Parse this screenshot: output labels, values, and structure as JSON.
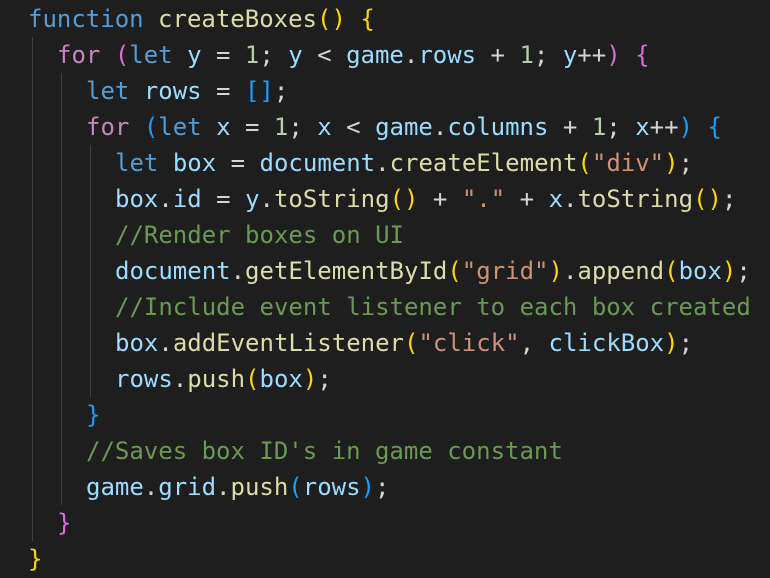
{
  "editor": {
    "theme": {
      "background": "#1e1e1e",
      "keyword": "#569cd6",
      "control": "#c586c0",
      "function": "#dcdcaa",
      "variable": "#9cdcfe",
      "number": "#b5cea8",
      "string": "#ce9178",
      "comment": "#6a9955",
      "bracket_level_1": "#ffd700",
      "bracket_level_2": "#da70d6",
      "bracket_level_3": "#179fff"
    },
    "lines": [
      {
        "indent": 0,
        "tokens": [
          [
            "kw",
            "function"
          ],
          [
            "op",
            " "
          ],
          [
            "fn",
            "createBoxes"
          ],
          [
            "b1",
            "()"
          ],
          [
            "op",
            " "
          ],
          [
            "b1",
            "{"
          ]
        ]
      },
      {
        "indent": 1,
        "tokens": [
          [
            "ctl",
            "for"
          ],
          [
            "op",
            " "
          ],
          [
            "b2",
            "("
          ],
          [
            "kw",
            "let"
          ],
          [
            "op",
            " "
          ],
          [
            "var",
            "y"
          ],
          [
            "op",
            " = "
          ],
          [
            "num",
            "1"
          ],
          [
            "op",
            "; "
          ],
          [
            "var",
            "y"
          ],
          [
            "op",
            " < "
          ],
          [
            "var",
            "game"
          ],
          [
            "op",
            "."
          ],
          [
            "var",
            "rows"
          ],
          [
            "op",
            " + "
          ],
          [
            "num",
            "1"
          ],
          [
            "op",
            "; "
          ],
          [
            "var",
            "y"
          ],
          [
            "op",
            "++"
          ],
          [
            "b2",
            ")"
          ],
          [
            "op",
            " "
          ],
          [
            "b2",
            "{"
          ]
        ]
      },
      {
        "indent": 2,
        "tokens": [
          [
            "kw",
            "let"
          ],
          [
            "op",
            " "
          ],
          [
            "var",
            "rows"
          ],
          [
            "op",
            " = "
          ],
          [
            "b3",
            "[]"
          ],
          [
            "op",
            ";"
          ]
        ]
      },
      {
        "indent": 2,
        "tokens": [
          [
            "ctl",
            "for"
          ],
          [
            "op",
            " "
          ],
          [
            "b3",
            "("
          ],
          [
            "kw",
            "let"
          ],
          [
            "op",
            " "
          ],
          [
            "var",
            "x"
          ],
          [
            "op",
            " = "
          ],
          [
            "num",
            "1"
          ],
          [
            "op",
            "; "
          ],
          [
            "var",
            "x"
          ],
          [
            "op",
            " < "
          ],
          [
            "var",
            "game"
          ],
          [
            "op",
            "."
          ],
          [
            "var",
            "columns"
          ],
          [
            "op",
            " + "
          ],
          [
            "num",
            "1"
          ],
          [
            "op",
            "; "
          ],
          [
            "var",
            "x"
          ],
          [
            "op",
            "++"
          ],
          [
            "b3",
            ")"
          ],
          [
            "op",
            " "
          ],
          [
            "b3",
            "{"
          ]
        ]
      },
      {
        "indent": 3,
        "tokens": [
          [
            "kw",
            "let"
          ],
          [
            "op",
            " "
          ],
          [
            "var",
            "box"
          ],
          [
            "op",
            " = "
          ],
          [
            "var",
            "document"
          ],
          [
            "op",
            "."
          ],
          [
            "fn",
            "createElement"
          ],
          [
            "b1",
            "("
          ],
          [
            "str",
            "\"div\""
          ],
          [
            "b1",
            ")"
          ],
          [
            "op",
            ";"
          ]
        ]
      },
      {
        "indent": 3,
        "tokens": [
          [
            "var",
            "box"
          ],
          [
            "op",
            "."
          ],
          [
            "var",
            "id"
          ],
          [
            "op",
            " = "
          ],
          [
            "var",
            "y"
          ],
          [
            "op",
            "."
          ],
          [
            "fn",
            "toString"
          ],
          [
            "b1",
            "()"
          ],
          [
            "op",
            " + "
          ],
          [
            "str",
            "\".\""
          ],
          [
            "op",
            " + "
          ],
          [
            "var",
            "x"
          ],
          [
            "op",
            "."
          ],
          [
            "fn",
            "toString"
          ],
          [
            "b1",
            "()"
          ],
          [
            "op",
            ";"
          ]
        ]
      },
      {
        "indent": 3,
        "tokens": [
          [
            "cmt",
            "//Render boxes on UI"
          ]
        ]
      },
      {
        "indent": 3,
        "tokens": [
          [
            "var",
            "document"
          ],
          [
            "op",
            "."
          ],
          [
            "fn",
            "getElementById"
          ],
          [
            "b1",
            "("
          ],
          [
            "str",
            "\"grid\""
          ],
          [
            "b1",
            ")"
          ],
          [
            "op",
            "."
          ],
          [
            "fn",
            "append"
          ],
          [
            "b1",
            "("
          ],
          [
            "var",
            "box"
          ],
          [
            "b1",
            ")"
          ],
          [
            "op",
            ";"
          ]
        ]
      },
      {
        "indent": 3,
        "tokens": [
          [
            "cmt",
            "//Include event listener to each box created"
          ]
        ]
      },
      {
        "indent": 3,
        "tokens": [
          [
            "var",
            "box"
          ],
          [
            "op",
            "."
          ],
          [
            "fn",
            "addEventListener"
          ],
          [
            "b1",
            "("
          ],
          [
            "str",
            "\"click\""
          ],
          [
            "op",
            ", "
          ],
          [
            "var",
            "clickBox"
          ],
          [
            "b1",
            ")"
          ],
          [
            "op",
            ";"
          ]
        ]
      },
      {
        "indent": 3,
        "tokens": [
          [
            "var",
            "rows"
          ],
          [
            "op",
            "."
          ],
          [
            "fn",
            "push"
          ],
          [
            "b1",
            "("
          ],
          [
            "var",
            "box"
          ],
          [
            "b1",
            ")"
          ],
          [
            "op",
            ";"
          ]
        ]
      },
      {
        "indent": 2,
        "tokens": [
          [
            "b3",
            "}"
          ]
        ]
      },
      {
        "indent": 2,
        "tokens": [
          [
            "cmt",
            "//Saves box ID's in game constant"
          ]
        ]
      },
      {
        "indent": 2,
        "tokens": [
          [
            "var",
            "game"
          ],
          [
            "op",
            "."
          ],
          [
            "var",
            "grid"
          ],
          [
            "op",
            "."
          ],
          [
            "fn",
            "push"
          ],
          [
            "b3",
            "("
          ],
          [
            "var",
            "rows"
          ],
          [
            "b3",
            ")"
          ],
          [
            "op",
            ";"
          ]
        ]
      },
      {
        "indent": 1,
        "tokens": [
          [
            "b2",
            "}"
          ]
        ]
      },
      {
        "indent": 0,
        "tokens": [
          [
            "b1",
            "}"
          ]
        ]
      }
    ]
  }
}
